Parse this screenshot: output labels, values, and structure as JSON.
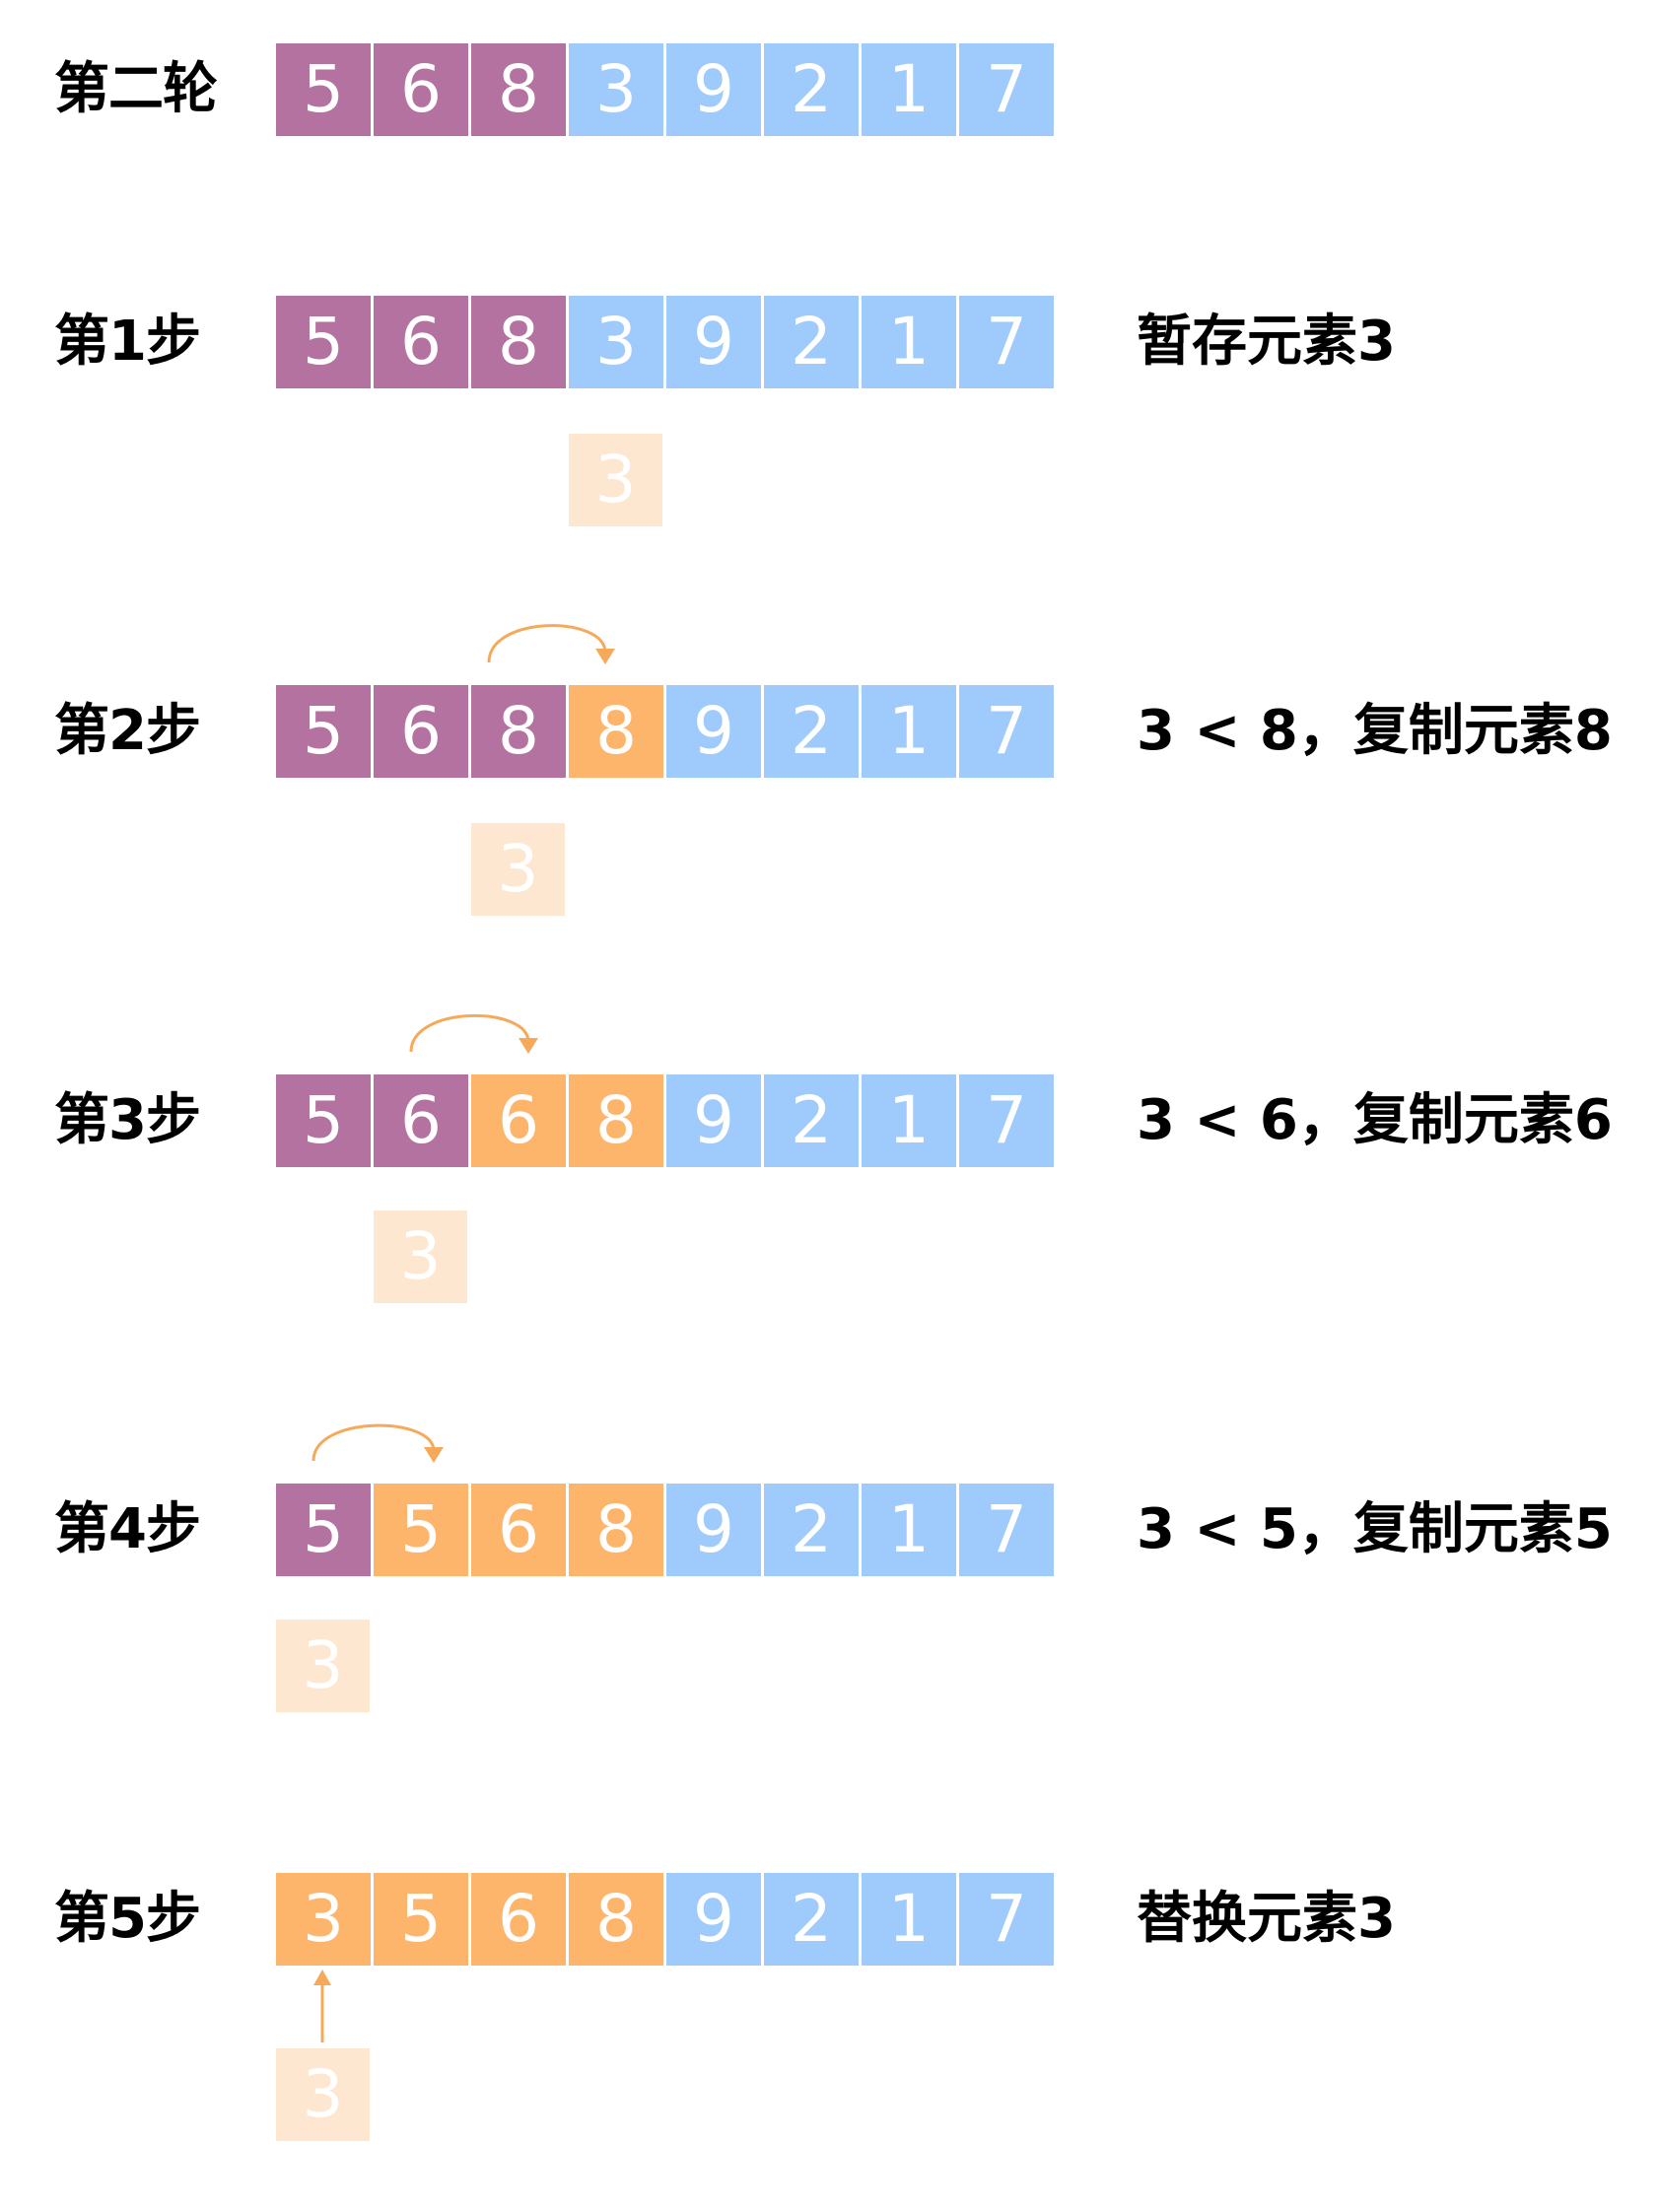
{
  "colors": {
    "sorted": "#b3729f",
    "unsorted": "#9ecbfb",
    "moved": "#fdb46b",
    "temp": "#fde7d1",
    "arrow": "#f5a95a"
  },
  "rows": [
    {
      "label": "第二轮",
      "desc": "",
      "cells": [
        {
          "v": "5",
          "s": "sorted"
        },
        {
          "v": "6",
          "s": "sorted"
        },
        {
          "v": "8",
          "s": "sorted"
        },
        {
          "v": "3",
          "s": "unsorted"
        },
        {
          "v": "9",
          "s": "unsorted"
        },
        {
          "v": "2",
          "s": "unsorted"
        },
        {
          "v": "1",
          "s": "unsorted"
        },
        {
          "v": "7",
          "s": "unsorted"
        }
      ],
      "temp": null
    },
    {
      "label": "第1步",
      "desc": "暂存元素3",
      "cells": [
        {
          "v": "5",
          "s": "sorted"
        },
        {
          "v": "6",
          "s": "sorted"
        },
        {
          "v": "8",
          "s": "sorted"
        },
        {
          "v": "3",
          "s": "unsorted"
        },
        {
          "v": "9",
          "s": "unsorted"
        },
        {
          "v": "2",
          "s": "unsorted"
        },
        {
          "v": "1",
          "s": "unsorted"
        },
        {
          "v": "7",
          "s": "unsorted"
        }
      ],
      "temp": {
        "v": "3",
        "col": 3
      }
    },
    {
      "label": "第2步",
      "desc": "3 < 8，复制元素8",
      "cells": [
        {
          "v": "5",
          "s": "sorted"
        },
        {
          "v": "6",
          "s": "sorted"
        },
        {
          "v": "8",
          "s": "sorted"
        },
        {
          "v": "8",
          "s": "moved"
        },
        {
          "v": "9",
          "s": "unsorted"
        },
        {
          "v": "2",
          "s": "unsorted"
        },
        {
          "v": "1",
          "s": "unsorted"
        },
        {
          "v": "7",
          "s": "unsorted"
        }
      ],
      "temp": {
        "v": "3",
        "col": 2
      }
    },
    {
      "label": "第3步",
      "desc": "3 < 6，复制元素6",
      "cells": [
        {
          "v": "5",
          "s": "sorted"
        },
        {
          "v": "6",
          "s": "sorted"
        },
        {
          "v": "6",
          "s": "moved"
        },
        {
          "v": "8",
          "s": "moved"
        },
        {
          "v": "9",
          "s": "unsorted"
        },
        {
          "v": "2",
          "s": "unsorted"
        },
        {
          "v": "1",
          "s": "unsorted"
        },
        {
          "v": "7",
          "s": "unsorted"
        }
      ],
      "temp": {
        "v": "3",
        "col": 1
      }
    },
    {
      "label": "第4步",
      "desc": "3 < 5，复制元素5",
      "cells": [
        {
          "v": "5",
          "s": "sorted"
        },
        {
          "v": "5",
          "s": "moved"
        },
        {
          "v": "6",
          "s": "moved"
        },
        {
          "v": "8",
          "s": "moved"
        },
        {
          "v": "9",
          "s": "unsorted"
        },
        {
          "v": "2",
          "s": "unsorted"
        },
        {
          "v": "1",
          "s": "unsorted"
        },
        {
          "v": "7",
          "s": "unsorted"
        }
      ],
      "temp": {
        "v": "3",
        "col": 0
      }
    },
    {
      "label": "第5步",
      "desc": "替换元素3",
      "cells": [
        {
          "v": "3",
          "s": "moved"
        },
        {
          "v": "5",
          "s": "moved"
        },
        {
          "v": "6",
          "s": "moved"
        },
        {
          "v": "8",
          "s": "moved"
        },
        {
          "v": "9",
          "s": "unsorted"
        },
        {
          "v": "2",
          "s": "unsorted"
        },
        {
          "v": "1",
          "s": "unsorted"
        },
        {
          "v": "7",
          "s": "unsorted"
        }
      ],
      "temp": {
        "v": "3",
        "col": 0
      }
    }
  ]
}
